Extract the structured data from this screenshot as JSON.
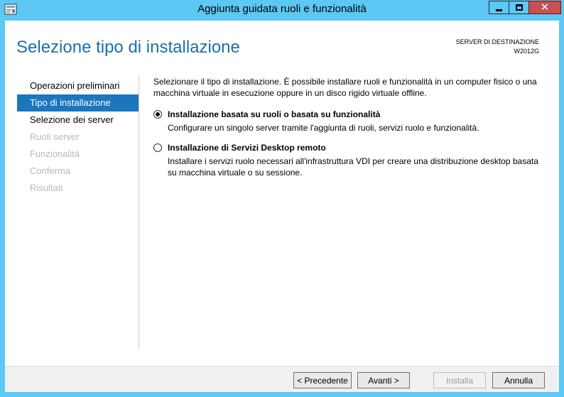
{
  "window": {
    "title": "Aggiunta guidata ruoli e funzionalità",
    "close_glyph": "✕"
  },
  "header": {
    "page_title": "Selezione tipo di installazione",
    "dest_label": "SERVER DI DESTINAZIONE",
    "dest_server": "W2012G"
  },
  "nav": {
    "items": [
      {
        "label": "Operazioni preliminari"
      },
      {
        "label": "Tipo di installazione"
      },
      {
        "label": "Selezione dei server"
      },
      {
        "label": "Ruoli server"
      },
      {
        "label": "Funzionalità"
      },
      {
        "label": "Conferma"
      },
      {
        "label": "Risultati"
      }
    ]
  },
  "content": {
    "intro": "Selezionare il tipo di installazione. È possibile installare ruoli e funzionalità in un computer fisico o una macchina virtuale in esecuzione oppure in un disco rigido virtuale offline.",
    "options": [
      {
        "label": "Installazione basata su ruoli o basata su funzionalità",
        "desc": "Configurare un singolo server tramite l'aggiunta di ruoli, servizi ruolo e funzionalità."
      },
      {
        "label": "Installazione di Servizi Desktop remoto",
        "desc": "Installare i servizi ruolo necessari all'infrastruttura VDI per creare una distribuzione desktop basata su macchina virtuale o su sessione."
      }
    ]
  },
  "footer": {
    "prev_label": "< Precedente",
    "next_label": "Avanti >",
    "install_label": "Installa",
    "cancel_label": "Annulla"
  },
  "colors": {
    "frame": "#5cc8f4",
    "accent": "#1b76bd",
    "title_text": "#1d6fa8",
    "close_button": "#c75050"
  }
}
